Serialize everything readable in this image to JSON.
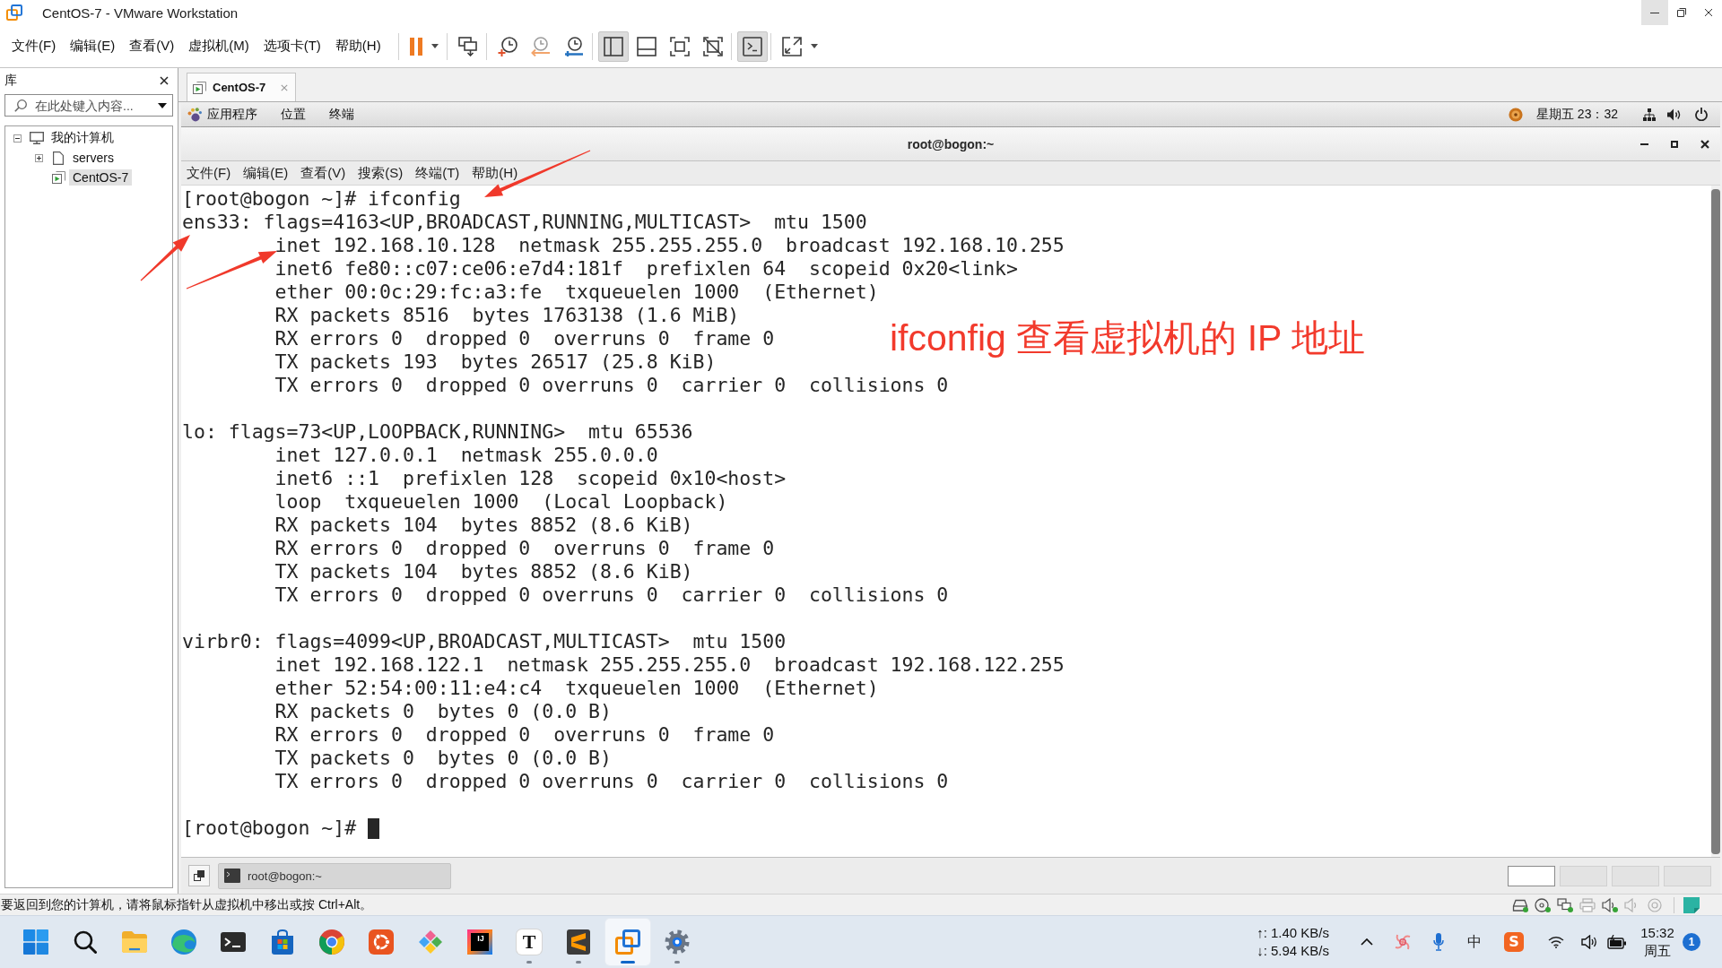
{
  "window": {
    "title": "CentOS-7 - VMware Workstation",
    "controls": [
      {
        "kind": "minimize",
        "hovered": true
      },
      {
        "kind": "restore",
        "hovered": false
      },
      {
        "kind": "close",
        "hovered": false
      }
    ]
  },
  "menu_bar": [
    "文件(F)",
    "编辑(E)",
    "查看(V)",
    "虚拟机(M)",
    "选项卡(T)",
    "帮助(H)"
  ],
  "toolbar": [
    {
      "items": [
        {
          "kind": "pause",
          "pressed": false,
          "dropdown": true
        }
      ]
    },
    {
      "items": [
        {
          "kind": "send-keys",
          "pressed": false,
          "dropdown": false
        }
      ]
    },
    {
      "items": [
        {
          "kind": "snapshot",
          "pressed": false,
          "dropdown": false
        },
        {
          "kind": "revert",
          "pressed": false,
          "dropdown": false
        },
        {
          "kind": "snapshot-manager",
          "pressed": false,
          "dropdown": false
        }
      ]
    },
    {
      "items": [
        {
          "kind": "library",
          "pressed": true,
          "dropdown": false
        },
        {
          "kind": "thumbnails",
          "pressed": false,
          "dropdown": false
        },
        {
          "kind": "full-screen",
          "pressed": false,
          "dropdown": false
        },
        {
          "kind": "unity",
          "pressed": false,
          "dropdown": false
        }
      ]
    },
    {
      "items": [
        {
          "kind": "console",
          "pressed": true,
          "dropdown": false
        }
      ]
    },
    {
      "items": [
        {
          "kind": "stretch",
          "pressed": false,
          "dropdown": true
        }
      ]
    }
  ],
  "library": {
    "title": "库",
    "search": {
      "placeholder": "在此处键入内容..."
    },
    "tree": [
      {
        "label": "我的计算机",
        "kind": "computer",
        "expanded": true,
        "selected": false,
        "children": [
          {
            "label": "servers",
            "kind": "folder",
            "expanded": false,
            "selected": false
          },
          {
            "label": "CentOS-7",
            "kind": "vm",
            "selected": true
          }
        ]
      }
    ]
  },
  "tabs": [
    {
      "label": "CentOS-7",
      "selected": true
    }
  ],
  "guest": {
    "top_bar": {
      "menus": [
        "应用程序",
        "位置",
        "终端"
      ],
      "clock": "星期五 23：32"
    },
    "terminal": {
      "title": "root@bogon:~",
      "menu": [
        "文件(F)",
        "编辑(E)",
        "查看(V)",
        "搜索(S)",
        "终端(T)",
        "帮助(H)"
      ],
      "command": "[root@bogon ~]# ifconfig",
      "interfaces": [
        {
          "header": "ens33: flags=4163<UP,BROADCAST,RUNNING,MULTICAST>  mtu 1500",
          "details": [
            "inet 192.168.10.128  netmask 255.255.255.0  broadcast 192.168.10.255",
            "inet6 fe80::c07:ce06:e7d4:181f  prefixlen 64  scopeid 0x20<link>",
            "ether 00:0c:29:fc:a3:fe  txqueuelen 1000  (Ethernet)",
            "RX packets 8516  bytes 1763138 (1.6 MiB)",
            "RX errors 0  dropped 0  overruns 0  frame 0",
            "TX packets 193  bytes 26517 (25.8 KiB)",
            "TX errors 0  dropped 0 overruns 0  carrier 0  collisions 0"
          ]
        },
        {
          "header": "lo: flags=73<UP,LOOPBACK,RUNNING>  mtu 65536",
          "details": [
            "inet 127.0.0.1  netmask 255.0.0.0",
            "inet6 ::1  prefixlen 128  scopeid 0x10<host>",
            "loop  txqueuelen 1000  (Local Loopback)",
            "RX packets 104  bytes 8852 (8.6 KiB)",
            "RX errors 0  dropped 0  overruns 0  frame 0",
            "TX packets 104  bytes 8852 (8.6 KiB)",
            "TX errors 0  dropped 0 overruns 0  carrier 0  collisions 0"
          ]
        },
        {
          "header": "virbr0: flags=4099<UP,BROADCAST,MULTICAST>  mtu 1500",
          "details": [
            "inet 192.168.122.1  netmask 255.255.255.0  broadcast 192.168.122.255",
            "ether 52:54:00:11:e4:c4  txqueuelen 1000  (Ethernet)",
            "RX packets 0  bytes 0 (0.0 B)",
            "RX errors 0  dropped 0  overruns 0  frame 0",
            "TX packets 0  bytes 0 (0.0 B)",
            "TX errors 0  dropped 0 overruns 0  carrier 0  collisions 0"
          ]
        }
      ],
      "prompt": "[root@bogon ~]#",
      "cursor": true
    },
    "bottom_panel": {
      "tasks": [
        {
          "label": "root@bogon:~",
          "selected": true
        }
      ],
      "workspaces": [
        {
          "selected": true
        },
        {
          "selected": false
        },
        {
          "selected": false
        },
        {
          "selected": false
        }
      ]
    }
  },
  "annotation": {
    "text": "ifconfig 查看虚拟机的 IP 地址"
  },
  "status_bar": {
    "message": "要返回到您的计算机，请将鼠标指针从虚拟机中移出或按 Ctrl+Alt。",
    "devices": [
      {
        "kind": "hard-disk",
        "connected": true
      },
      {
        "kind": "optical",
        "connected": true
      },
      {
        "kind": "network",
        "connected": true
      },
      {
        "kind": "printer",
        "connected": false
      },
      {
        "kind": "sound",
        "connected": true
      },
      {
        "kind": "sound",
        "connected": false
      },
      {
        "kind": "camera",
        "connected": false
      }
    ]
  },
  "taskbar": {
    "apps": [
      {
        "kind": "start",
        "running": false,
        "active": false
      },
      {
        "kind": "search",
        "running": false,
        "active": false
      },
      {
        "kind": "folder",
        "running": false,
        "active": false
      },
      {
        "kind": "wave",
        "running": false,
        "active": false
      },
      {
        "kind": "terminal",
        "running": false,
        "active": false
      },
      {
        "kind": "bag",
        "running": false,
        "active": false
      },
      {
        "kind": "segmented",
        "running": false,
        "active": false
      },
      {
        "kind": "ring",
        "running": false,
        "active": false
      },
      {
        "kind": "diamond",
        "running": false,
        "active": false
      },
      {
        "kind": "letter-tile",
        "glyph": "IJ",
        "running": false,
        "active": false
      },
      {
        "kind": "letter",
        "glyph": "T",
        "running": true,
        "active": false
      },
      {
        "kind": "stripes",
        "running": true,
        "active": false
      },
      {
        "kind": "squares",
        "running": true,
        "active": true
      },
      {
        "kind": "gear",
        "running": true,
        "active": false
      }
    ],
    "network_speed": [
      "↑: 1.40 KB/s",
      "↓: 5.94 KB/s"
    ],
    "tray": [
      {
        "kind": "chevron"
      },
      {
        "kind": "pinwheel"
      },
      {
        "kind": "microphone"
      },
      {
        "kind": "ime",
        "glyph": "中"
      },
      {
        "kind": "input-method",
        "glyph": "S"
      },
      {
        "kind": "wifi"
      },
      {
        "kind": "speaker"
      },
      {
        "kind": "battery"
      }
    ],
    "time": "15:32",
    "day": "周五",
    "notifications": "1"
  }
}
